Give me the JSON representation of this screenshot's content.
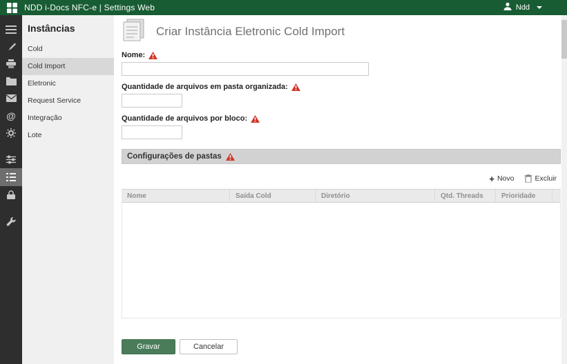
{
  "topbar": {
    "title": "NDD i-Docs NFC-e | Settings Web",
    "user": "Ndd"
  },
  "sidebar": {
    "icons": [
      "menu-icon",
      "brush-icon",
      "printer-icon",
      "folder-icon",
      "mail-icon",
      "at-icon",
      "gear-icon",
      "sliders-icon",
      "list-icon",
      "lock-icon",
      "wrench-icon"
    ],
    "selected_icon": "list-icon"
  },
  "panel": {
    "title": "Instâncias",
    "items": [
      {
        "label": "Cold",
        "selected": false
      },
      {
        "label": "Cold Import",
        "selected": true
      },
      {
        "label": "Eletronic",
        "selected": false
      },
      {
        "label": "Request Service",
        "selected": false
      },
      {
        "label": "Integração",
        "selected": false
      },
      {
        "label": "Lote",
        "selected": false
      }
    ]
  },
  "main": {
    "title": "Criar Instância Eletronic Cold Import",
    "fields": [
      {
        "label": "Nome:",
        "value": "",
        "required": true
      },
      {
        "label": "Quantidade de arquivos em pasta organizada:",
        "value": "",
        "required": true
      },
      {
        "label": "Quantidade de arquivos por bloco:",
        "value": "",
        "required": true
      }
    ],
    "section": {
      "title": "Configurações de pastas",
      "required": true,
      "toolbar": {
        "new": "Novo",
        "delete": "Excluir"
      },
      "table": {
        "headers": [
          "Nome",
          "Saída Cold",
          "Diretório",
          "Qtd. Threads",
          "Prioridade"
        ],
        "rows": []
      }
    },
    "buttons": {
      "save": "Gravar",
      "cancel": "Cancelar"
    }
  },
  "colors": {
    "topbar_green": "#185c33",
    "save_button_green": "#4a7c59",
    "warning_red": "#cf3529",
    "rail_dark": "#2e2e2e",
    "panel_gray": "#f0f0f0",
    "section_bar_gray": "#d2d2d2"
  }
}
